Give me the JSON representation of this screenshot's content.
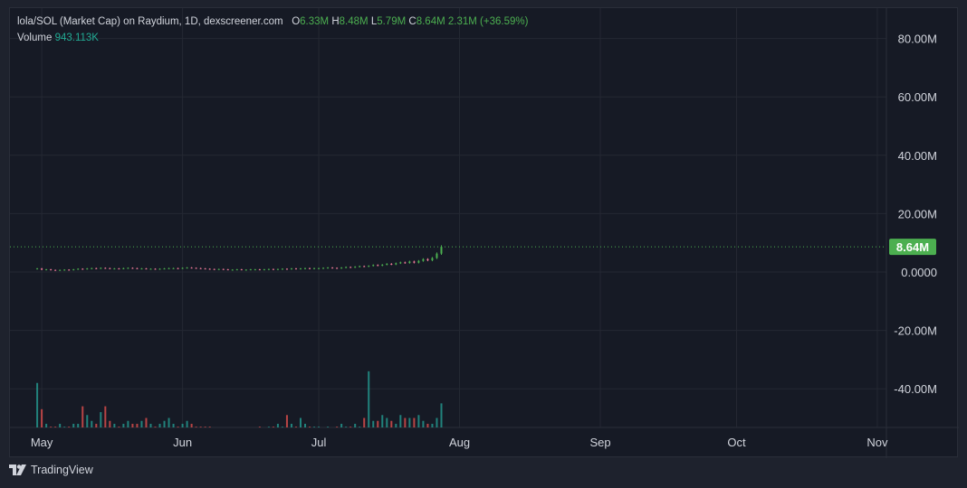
{
  "header": {
    "title": "lola/SOL (Market Cap) on Raydium, 1D, dexscreener.com",
    "o_label": "O",
    "o_value": "6.33M",
    "h_label": "H",
    "h_value": "8.48M",
    "l_label": "L",
    "l_value": "5.79M",
    "c_label": "C",
    "c_value": "8.64M",
    "change": "2.31M (+36.59%)",
    "volume_label": "Volume",
    "volume_value": "943.113K"
  },
  "footer": {
    "brand": "TradingView",
    "logo_icon": "tradingview-logo-icon"
  },
  "chart_data": {
    "type": "candlestick",
    "ylim": [
      -55,
      90
    ],
    "yticks": [
      80,
      60,
      40,
      20,
      0,
      -20,
      -40
    ],
    "ytick_labels": [
      "80.00M",
      "60.00M",
      "40.00M",
      "20.00M",
      "0.0000",
      "-20.00M",
      "-40.00M"
    ],
    "xlim": [
      "2024-04-24",
      "2024-11-03"
    ],
    "xticks": [
      "2024-05-01",
      "2024-06-01",
      "2024-07-01",
      "2024-08-01",
      "2024-09-01",
      "2024-10-01",
      "2024-11-01"
    ],
    "xtick_labels": [
      "May",
      "Jun",
      "Jul",
      "Aug",
      "Sep",
      "Oct",
      "Nov"
    ],
    "last_price": 8.64,
    "last_price_label": "8.64M",
    "price_unit": "M",
    "price_series": {
      "start_date": "2024-04-30",
      "close": [
        1.2,
        0.8,
        0.9,
        0.7,
        0.6,
        0.7,
        0.8,
        0.7,
        0.9,
        1.1,
        1.0,
        1.2,
        1.3,
        1.2,
        1.4,
        1.3,
        1.2,
        1.2,
        1.1,
        1.3,
        1.4,
        1.3,
        1.2,
        1.2,
        1.1,
        1.1,
        1.0,
        1.1,
        1.2,
        1.3,
        1.3,
        1.2,
        1.4,
        1.5,
        1.4,
        1.3,
        1.2,
        1.1,
        1.0,
        0.9,
        1.0,
        0.9,
        0.8,
        0.8,
        0.9,
        0.8,
        0.8,
        0.9,
        0.9,
        0.8,
        0.9,
        1.0,
        0.9,
        1.0,
        1.1,
        1.0,
        1.2,
        1.1,
        1.2,
        1.3,
        1.2,
        1.3,
        1.3,
        1.4,
        1.5,
        1.4,
        1.3,
        1.5,
        1.7,
        1.6,
        1.8,
        2.0,
        1.9,
        2.1,
        2.4,
        2.2,
        2.5,
        2.8,
        2.6,
        3.0,
        3.3,
        3.1,
        3.6,
        3.2,
        3.8,
        4.4,
        4.0,
        4.8,
        6.3,
        8.64
      ],
      "volume": [
        17,
        8,
        3,
        2,
        2,
        3,
        2,
        2,
        3,
        3,
        9,
        6,
        4,
        3,
        7,
        9,
        4,
        3,
        2,
        3,
        4,
        3,
        3,
        4,
        5,
        3,
        2,
        3,
        4,
        5,
        3,
        2,
        3,
        4,
        3,
        2,
        2,
        2,
        2,
        1,
        1,
        1,
        1,
        1,
        1,
        1,
        1,
        1,
        1,
        2,
        1,
        2,
        2,
        3,
        2,
        6,
        3,
        2,
        5,
        3,
        2,
        2,
        2,
        1,
        2,
        1,
        2,
        3,
        2,
        2,
        3,
        2,
        5,
        21,
        4,
        4,
        6,
        5,
        4,
        3,
        6,
        5,
        5,
        5,
        6,
        4,
        3,
        3,
        5,
        10,
        12
      ]
    },
    "colors": {
      "up": "#26a69a",
      "down": "#ef5350",
      "candle_up": "#4caf50",
      "candle_down": "#ef7a9a",
      "grid": "#242833",
      "axis_text": "#d1d4dc",
      "price_tag": "#4caf50"
    }
  }
}
